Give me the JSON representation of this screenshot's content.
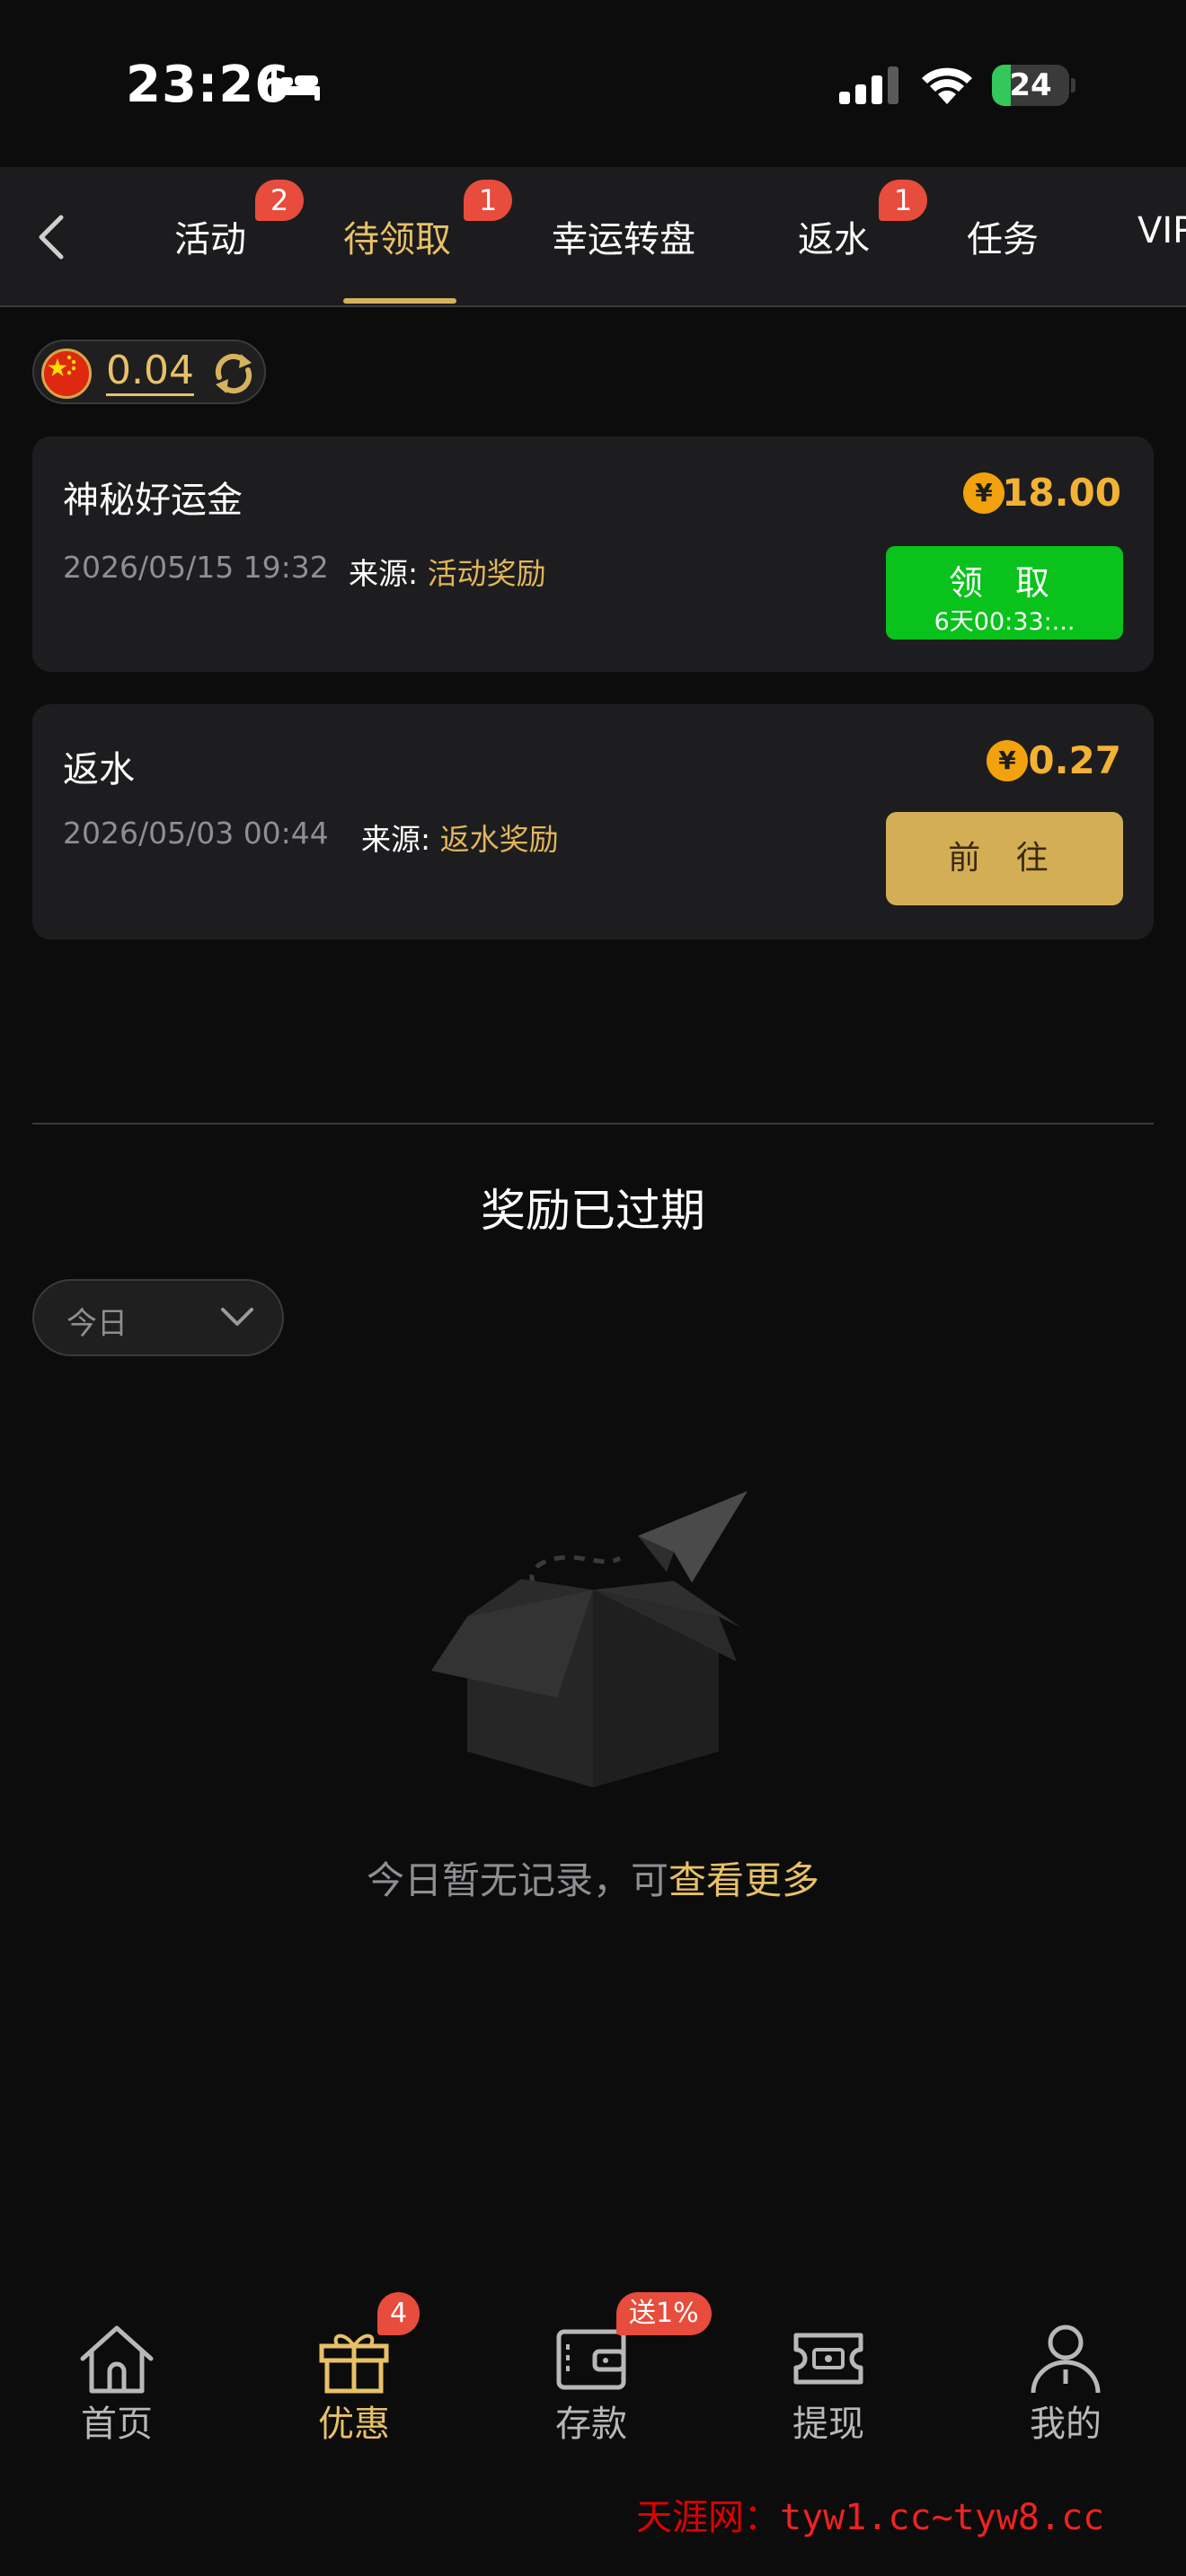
{
  "status_bar": {
    "time": "23:26",
    "battery": "24",
    "battery_level": 0.24
  },
  "tabs": [
    {
      "label": "活动",
      "badge": "2"
    },
    {
      "label": "待领取",
      "badge": "1",
      "active": true
    },
    {
      "label": "幸运转盘"
    },
    {
      "label": "返水",
      "badge": "1"
    },
    {
      "label": "任务"
    },
    {
      "label": "VIP"
    }
  ],
  "balance": {
    "value": "0.04"
  },
  "cards": [
    {
      "title": "神秘好运金",
      "time": "2026/05/15 19:32",
      "source_label": "来源:",
      "source_value": "活动奖励",
      "amount": "18.00",
      "button_label": "领 取",
      "button_timer": "6天00:33:..."
    },
    {
      "title": "返水",
      "time": "2026/05/03 00:44",
      "source_label": "来源:",
      "source_value": "返水奖励",
      "amount": "0.27",
      "button_label": "前 往"
    }
  ],
  "coin_symbol": "¥",
  "expired": {
    "title": "奖励已过期",
    "filter_value": "今日",
    "empty_text": "今日暂无记录，可",
    "empty_link": "查看更多"
  },
  "bottom_nav": [
    {
      "label": "首页",
      "icon": "home-icon"
    },
    {
      "label": "优惠",
      "icon": "gift-icon",
      "badge": "4",
      "active": true
    },
    {
      "label": "存款",
      "icon": "wallet-icon",
      "badge": "送1%"
    },
    {
      "label": "提现",
      "icon": "ticket-icon"
    },
    {
      "label": "我的",
      "icon": "user-icon"
    }
  ],
  "watermark": {
    "name": "天涯网：",
    "url": "tyw1.cc~tyw8.cc"
  },
  "colors": {
    "accent": "#e8c167",
    "claim_green": "#09c21b",
    "goto_gold": "#d4ae55",
    "badge_red": "#e74c3c",
    "background": "#0c0c0c",
    "card": "#1d1d1f"
  }
}
